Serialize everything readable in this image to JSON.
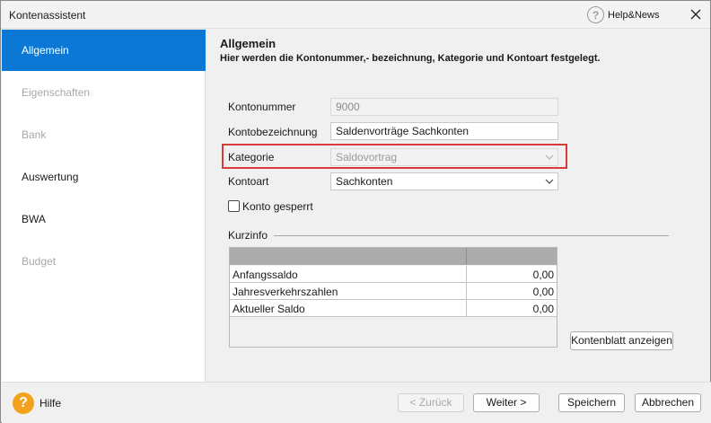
{
  "window": {
    "title": "Kontenassistent",
    "help_news_label": "Help&News"
  },
  "sidebar": {
    "items": [
      {
        "label": "Allgemein",
        "state": "active"
      },
      {
        "label": "Eigenschaften",
        "state": "disabled"
      },
      {
        "label": "Bank",
        "state": "disabled"
      },
      {
        "label": "Auswertung",
        "state": "normal"
      },
      {
        "label": "BWA",
        "state": "normal"
      },
      {
        "label": "Budget",
        "state": "disabled"
      }
    ]
  },
  "main": {
    "title": "Allgemein",
    "subtitle": "Hier werden die Kontonummer,- bezeichnung, Kategorie und Kontoart festgelegt.",
    "fields": {
      "kontonummer_label": "Kontonummer",
      "kontonummer_value": "9000",
      "kontobezeichnung_label": "Kontobezeichnung",
      "kontobezeichnung_value": "Saldenvorträge Sachkonten",
      "kategorie_label": "Kategorie",
      "kategorie_value": "Saldovortrag",
      "kontoart_label": "Kontoart",
      "kontoart_value": "Sachkonten",
      "konto_gesperrt_label": "Konto gesperrt"
    },
    "kurzinfo": {
      "section_label": "Kurzinfo",
      "rows": [
        {
          "label": "Anfangssaldo",
          "value": "0,00"
        },
        {
          "label": "Jahresverkehrszahlen",
          "value": "0,00"
        },
        {
          "label": "Aktueller Saldo",
          "value": "0,00"
        }
      ],
      "kontenblatt_button": "Kontenblatt anzeigen"
    }
  },
  "footer": {
    "hilfe_label": "Hilfe",
    "zurueck_button": "< Zurück",
    "weiter_button": "Weiter >",
    "speichern_button": "Speichern",
    "abbrechen_button": "Abbrechen"
  },
  "colors": {
    "accent": "#0a78d4",
    "highlight_border": "#d93a3a",
    "help_icon": "#f2a21b"
  }
}
